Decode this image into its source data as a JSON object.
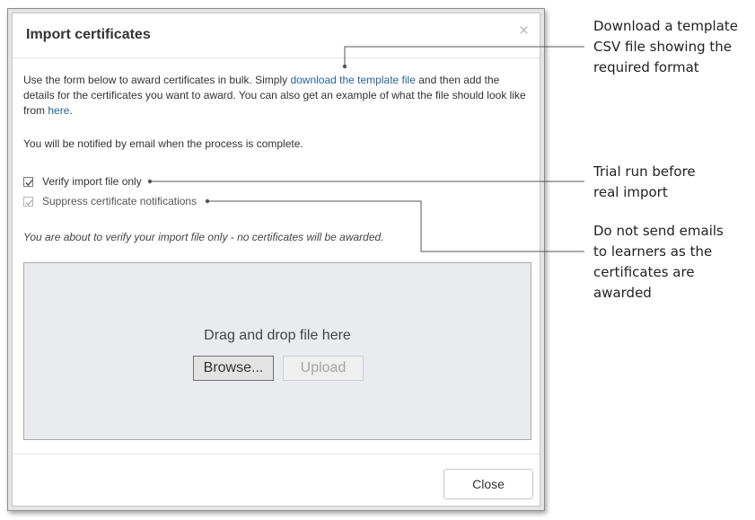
{
  "dialog": {
    "title": "Import certificates",
    "close_icon": "×",
    "intro_part1": "Use the form below to award certificates in bulk. Simply ",
    "template_link": "download the template file",
    "intro_part2": " and then add the details for the certificates you want to award. You can also get an example of what the file should look like from ",
    "example_link": "here",
    "intro_end": ".",
    "notify_text": "You will be notified by email when the process is complete.",
    "options": [
      {
        "label": "Verify import file only",
        "checked": true,
        "enabled": true
      },
      {
        "label": "Suppress certificate notifications",
        "checked": true,
        "enabled": false
      }
    ],
    "notice": "You are about to verify your import file only - no certificates will be awarded.",
    "dropzone": {
      "text": "Drag and drop file here",
      "browse_label": "Browse...",
      "upload_label": "Upload"
    },
    "footer": {
      "close_label": "Close"
    }
  },
  "callouts": {
    "template": "Download a template\nCSV file showing the\nrequired format",
    "trial": "Trial run before\nreal import",
    "emails": "Do not send emails\nto learners as the\ncertificates are\nawarded"
  },
  "colors": {
    "link": "#2a6496",
    "dropzone_bg": "#eaebee",
    "leader_line": "#555555"
  }
}
